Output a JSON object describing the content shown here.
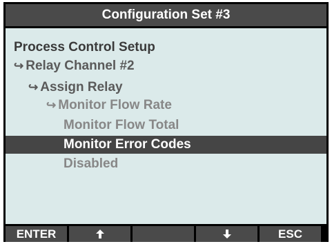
{
  "title": "Configuration Set #3",
  "menu": {
    "root": "Process Control Setup",
    "level1": "Relay Channel #2",
    "level2": "Assign Relay",
    "level3": "Monitor Flow Rate",
    "options": [
      "Monitor Flow Total",
      "Monitor Error Codes",
      "Disabled"
    ],
    "selected_option": "Monitor Error Codes"
  },
  "softkeys": [
    {
      "label": "ENTER",
      "icon": ""
    },
    {
      "label": "",
      "icon": "up-arrow-icon"
    },
    {
      "label": "",
      "icon": ""
    },
    {
      "label": "",
      "icon": "down-arrow-icon"
    },
    {
      "label": "ESC",
      "icon": ""
    }
  ],
  "colors": {
    "screen_bg": "#dbeaea",
    "bar_bg": "#4a4a4a",
    "highlight_bg": "#454545",
    "frame": "#000000"
  }
}
